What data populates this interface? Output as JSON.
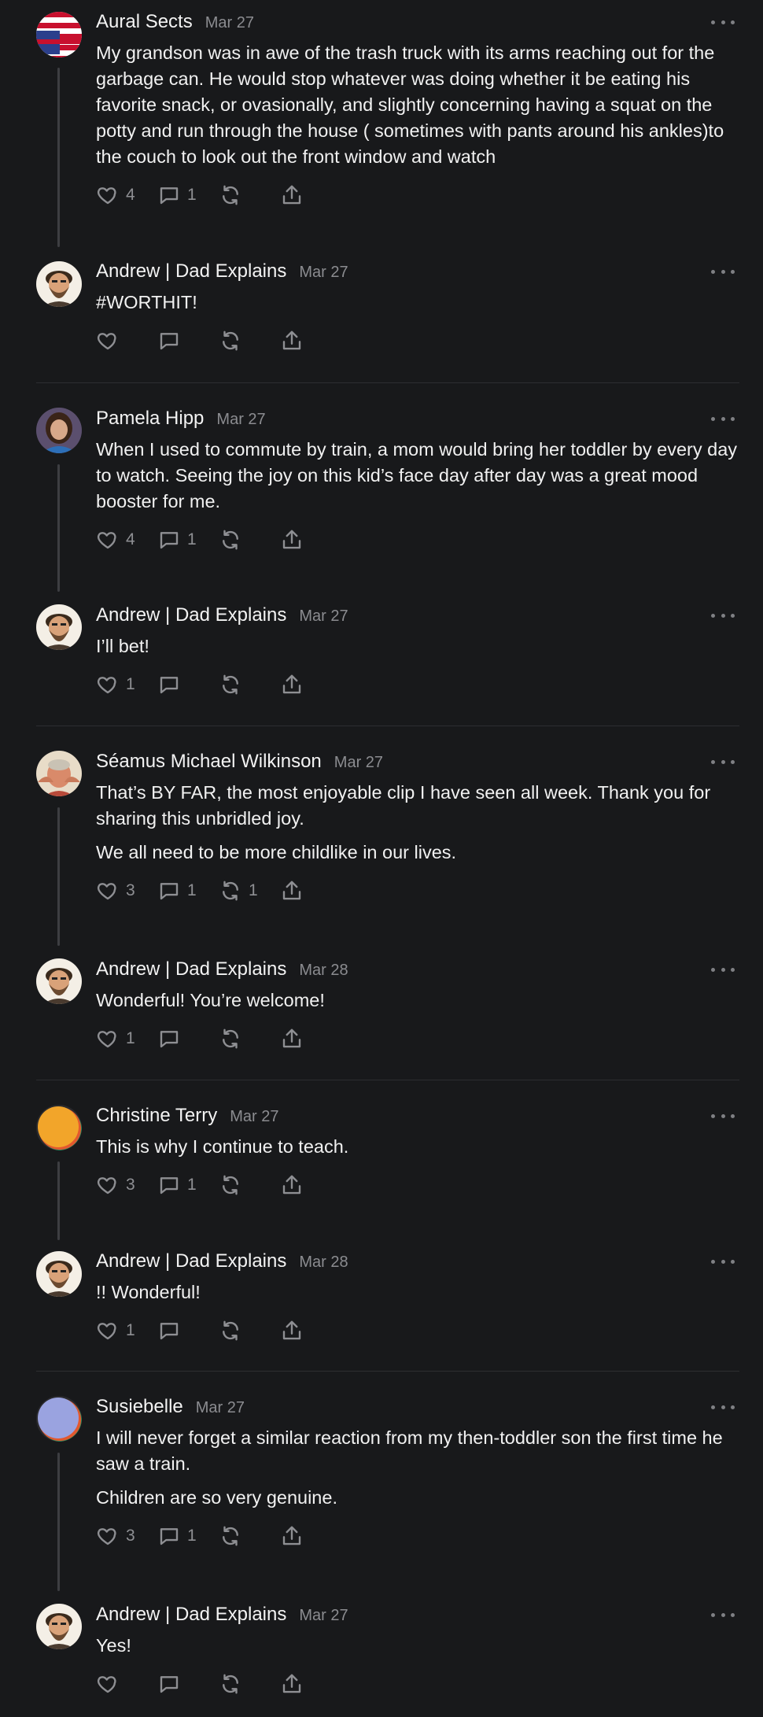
{
  "threads": [
    {
      "post": {
        "name": "Aural Sects",
        "date": "Mar 27",
        "avatar": "flag-avatar",
        "paragraphs": [
          "My grandson was in awe of the trash truck with its arms reaching out for the garbage can. He would stop whatever was doing whether it be eating his favorite snack, or ovasionally, and slightly concerning having a squat on the potty and run through the house ( sometimes with pants around his ankles)to the couch to look out the front window and watch"
        ],
        "likes": "4",
        "replies": "1",
        "reposts": ""
      },
      "reply": {
        "name": "Andrew | Dad Explains",
        "date": "Mar 27",
        "avatar": "bearded-avatar",
        "paragraphs": [
          "#WORTHIT!"
        ],
        "likes": "",
        "replies": "",
        "reposts": ""
      }
    },
    {
      "post": {
        "name": "Pamela Hipp",
        "date": "Mar 27",
        "avatar": "photo-avatar",
        "paragraphs": [
          "When I used to commute by train, a mom would bring her toddler by every day to watch. Seeing the joy on this kid’s face day after day was a great mood booster for me."
        ],
        "likes": "4",
        "replies": "1",
        "reposts": ""
      },
      "reply": {
        "name": "Andrew | Dad Explains",
        "date": "Mar 27",
        "avatar": "bearded-avatar",
        "paragraphs": [
          "I’ll bet!"
        ],
        "likes": "1",
        "replies": "",
        "reposts": ""
      }
    },
    {
      "post": {
        "name": "Séamus Michael Wilkinson",
        "date": "Mar 27",
        "avatar": "photo-avatar-2",
        "paragraphs": [
          "That’s BY FAR, the most enjoyable clip I have seen all week. Thank you for sharing this unbridled joy.",
          "We all need to be more childlike in our lives."
        ],
        "likes": "3",
        "replies": "1",
        "reposts": "1"
      },
      "reply": {
        "name": "Andrew | Dad Explains",
        "date": "Mar 28",
        "avatar": "bearded-avatar",
        "paragraphs": [
          "Wonderful! You’re welcome!"
        ],
        "likes": "1",
        "replies": "",
        "reposts": ""
      }
    },
    {
      "post": {
        "name": "Christine Terry",
        "date": "Mar 27",
        "avatar": "default-avatar-orange",
        "paragraphs": [
          "This is why I continue to teach."
        ],
        "likes": "3",
        "replies": "1",
        "reposts": ""
      },
      "reply": {
        "name": "Andrew | Dad Explains",
        "date": "Mar 28",
        "avatar": "bearded-avatar",
        "paragraphs": [
          "!! Wonderful!"
        ],
        "likes": "1",
        "replies": "",
        "reposts": ""
      }
    },
    {
      "post": {
        "name": "Susiebelle",
        "date": "Mar 27",
        "avatar": "default-avatar-blue",
        "paragraphs": [
          "I will never forget a similar reaction from my then-toddler son the first time he saw a train.",
          "Children are so very genuine."
        ],
        "likes": "3",
        "replies": "1",
        "reposts": ""
      },
      "reply": {
        "name": "Andrew | Dad Explains",
        "date": "Mar 27",
        "avatar": "bearded-avatar",
        "paragraphs": [
          "Yes!"
        ],
        "likes": "",
        "replies": "",
        "reposts": ""
      }
    }
  ]
}
